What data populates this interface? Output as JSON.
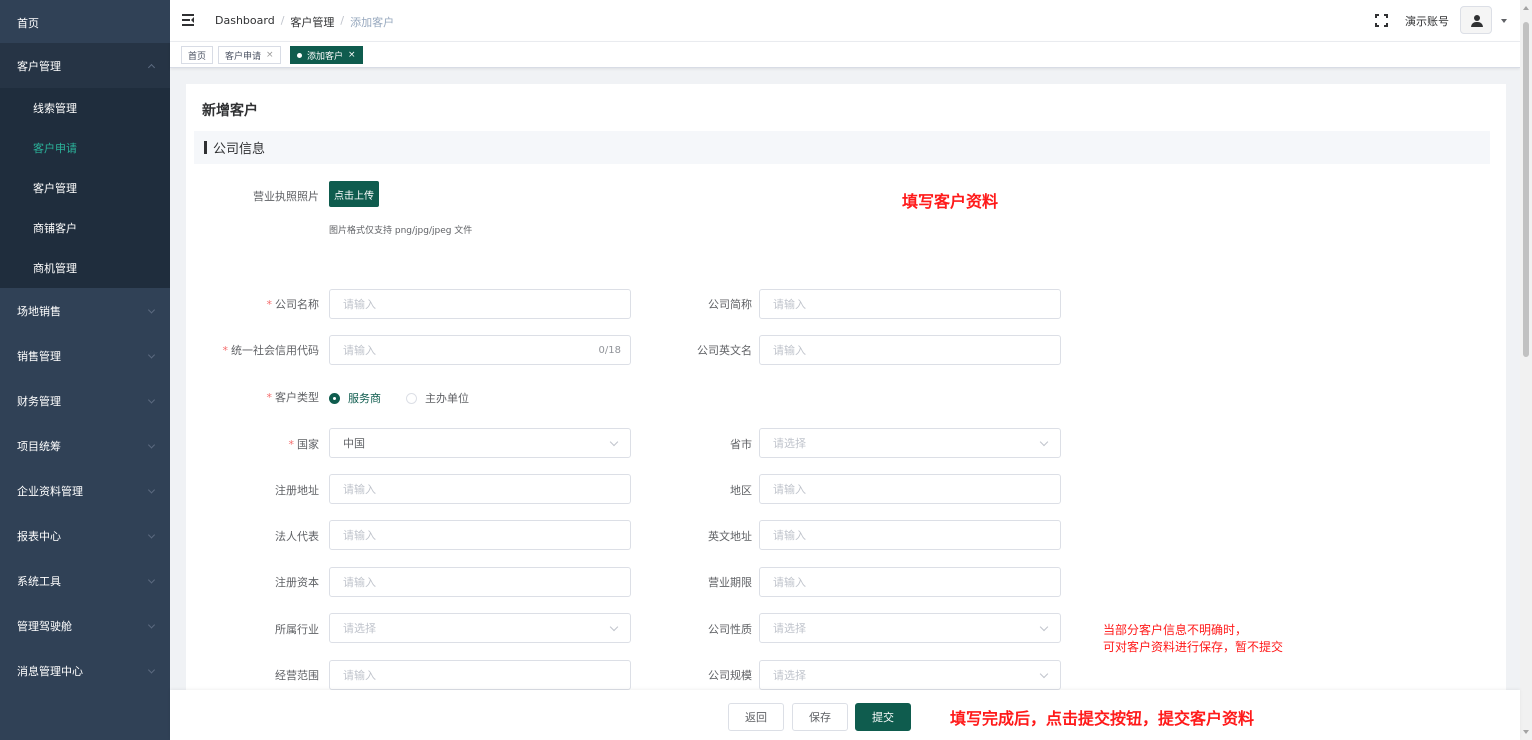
{
  "sidebar": {
    "home": "首页",
    "customer_group": "客户管理",
    "sub_items": [
      "线索管理",
      "客户申请",
      "客户管理",
      "商铺客户",
      "商机管理"
    ],
    "groups": [
      "场地销售",
      "销售管理",
      "财务管理",
      "项目统筹",
      "企业资料管理",
      "报表中心",
      "系统工具",
      "管理驾驶舱",
      "消息管理中心"
    ]
  },
  "header": {
    "breadcrumb": [
      "Dashboard",
      "客户管理",
      "添加客户"
    ],
    "account": "演示账号"
  },
  "tags": {
    "home": "首页",
    "customer_apply": "客户申请",
    "add_customer": "添加客户"
  },
  "page": {
    "title": "新增客户",
    "section_title": "公司信息"
  },
  "form": {
    "license_label": "营业执照照片",
    "upload_label": "点击上传",
    "upload_tip": "图片格式仅支持 png/jpg/jpeg 文件",
    "company_name": {
      "label": "公司名称",
      "placeholder": "请输入"
    },
    "company_short": {
      "label": "公司简称",
      "placeholder": "请输入"
    },
    "credit_code": {
      "label": "统一社会信用代码",
      "placeholder": "请输入",
      "count": "0/18"
    },
    "english_name": {
      "label": "公司英文名",
      "placeholder": "请输入"
    },
    "customer_type": {
      "label": "客户类型",
      "options": [
        "服务商",
        "主办单位"
      ],
      "selected": "服务商"
    },
    "country": {
      "label": "国家",
      "value": "中国"
    },
    "province": {
      "label": "省市",
      "placeholder": "请选择"
    },
    "reg_address": {
      "label": "注册地址",
      "placeholder": "请输入"
    },
    "region": {
      "label": "地区",
      "placeholder": "请输入"
    },
    "legal_rep": {
      "label": "法人代表",
      "placeholder": "请输入"
    },
    "english_address": {
      "label": "英文地址",
      "placeholder": "请输入"
    },
    "reg_capital": {
      "label": "注册资本",
      "placeholder": "请输入"
    },
    "business_term": {
      "label": "营业期限",
      "placeholder": "请输入"
    },
    "industry": {
      "label": "所属行业",
      "placeholder": "请选择"
    },
    "company_nature": {
      "label": "公司性质",
      "placeholder": "请选择"
    },
    "business_scope": {
      "label": "经营范围",
      "placeholder": "请输入"
    },
    "company_size": {
      "label": "公司规模",
      "placeholder": "请选择"
    }
  },
  "annotations": {
    "fill_info": "填写客户资料",
    "save_hint_line1": "当部分客户信息不明确时，",
    "save_hint_line2": "可对客户资料进行保存，暂不提交",
    "submit_hint": "填写完成后，点击提交按钮，提交客户资料"
  },
  "footer": {
    "back": "返回",
    "save": "保存",
    "submit": "提交"
  },
  "colors": {
    "sidebar_bg": "#304156",
    "submenu_bg": "#1f2d3d",
    "primary": "#0f5c4e",
    "active_text": "#2bb39a",
    "annotation": "#ff1a1a"
  }
}
